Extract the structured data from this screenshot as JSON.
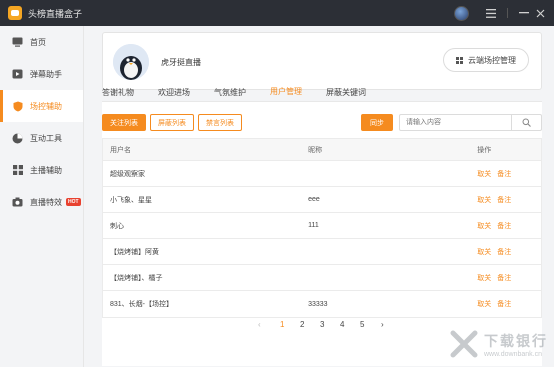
{
  "app": {
    "title": "头榜直播盒子"
  },
  "sidebar": {
    "items": [
      {
        "label": "首页",
        "icon": "monitor-icon"
      },
      {
        "label": "弹幕助手",
        "icon": "play-icon"
      },
      {
        "label": "场控辅助",
        "icon": "shield-icon",
        "active": true
      },
      {
        "label": "互动工具",
        "icon": "pie-icon"
      },
      {
        "label": "主播辅助",
        "icon": "grid-icon"
      },
      {
        "label": "直播特效",
        "icon": "camera-icon",
        "badge": "HOT"
      }
    ]
  },
  "profile": {
    "username": "虎牙挺直播",
    "cloud_button": "云端场控管理"
  },
  "tabs": [
    "答谢礼物",
    "欢迎进场",
    "气氛维护",
    "用户管理",
    "屏蔽关键词"
  ],
  "active_tab": 3,
  "subtabs": [
    "关注列表",
    "屏蔽列表",
    "禁言列表"
  ],
  "sync_label": "同步",
  "search": {
    "placeholder": "请输入内容"
  },
  "table": {
    "headers": [
      "用户名",
      "昵称",
      "操作"
    ],
    "rows": [
      {
        "user": "超级观察家",
        "nick": ""
      },
      {
        "user": "小飞象、星星",
        "nick": "eee"
      },
      {
        "user": "刺心",
        "nick": "111"
      },
      {
        "user": "【烧烤铺】阿黄",
        "nick": ""
      },
      {
        "user": "【烧烤铺】、橘子",
        "nick": ""
      },
      {
        "user": "831、长烟-【场控】",
        "nick": "33333"
      }
    ],
    "actions": [
      "取关",
      "备注"
    ]
  },
  "pagination": {
    "prev": "‹",
    "pages": [
      "1",
      "2",
      "3",
      "4",
      "5"
    ],
    "current": "1",
    "next": "›"
  },
  "watermark": {
    "text": "下载银行",
    "url": "www.downbank.cn"
  },
  "colors": {
    "accent": "#f58b1f",
    "titlebar": "#2c2f36"
  }
}
